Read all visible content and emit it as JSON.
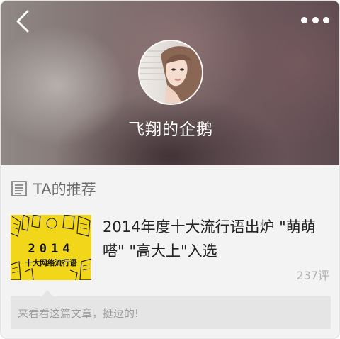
{
  "header": {
    "back_icon": "chevron-left-icon",
    "more_icon": "more-dots-icon",
    "username": "飞翔的企鹅"
  },
  "recommend": {
    "icon": "document-lines-icon",
    "title": "TA的推荐",
    "article": {
      "thumbnail": {
        "year": "2014",
        "subtitle": "十大网络流行语"
      },
      "title": "2014年度十大流行语出炉 \"萌萌嗒\" \"高大上\"入选",
      "comments": "237评"
    },
    "note": "来看看这篇文章，挺逗的!"
  },
  "colors": {
    "thumb_yellow": "#f2d61a",
    "note_bg": "#e5e5e5",
    "muted_text": "#9b9b9b"
  }
}
